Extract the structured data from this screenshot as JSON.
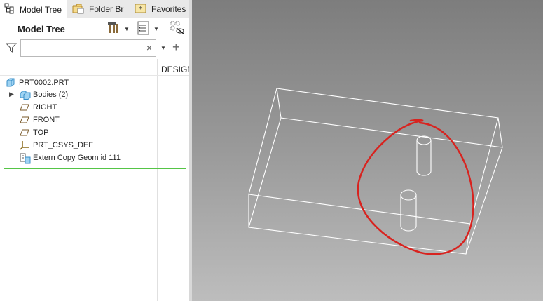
{
  "tabs": [
    {
      "label": "Model Tree",
      "icon": "model-tree-icon"
    },
    {
      "label": "Folder Br",
      "icon": "folder-browser-icon"
    },
    {
      "label": "Favorites",
      "icon": "favorites-icon"
    }
  ],
  "tree_header": {
    "title": "Model Tree",
    "tools": [
      "settings-tools-icon",
      "tree-columns-icon",
      "show-hide-icon"
    ]
  },
  "filter": {
    "search_value": "",
    "clear_symbol": "×",
    "add_symbol": "+"
  },
  "column_header": "DESIGN",
  "tree_items": [
    {
      "label": "PRT0002.PRT",
      "icon": "part-icon",
      "expandable": false
    },
    {
      "label": "Bodies (2)",
      "icon": "bodies-icon",
      "expandable": true
    },
    {
      "label": "RIGHT",
      "icon": "datum-plane-icon",
      "expandable": false
    },
    {
      "label": "FRONT",
      "icon": "datum-plane-icon",
      "expandable": false
    },
    {
      "label": "TOP",
      "icon": "datum-plane-icon",
      "expandable": false
    },
    {
      "label": "PRT_CSYS_DEF",
      "icon": "coordinate-system-icon",
      "expandable": false
    },
    {
      "label": "Extern Copy Geom id 111",
      "icon": "copy-geom-icon",
      "expandable": false
    }
  ],
  "insert_marker_color": "#55c546",
  "viewport": {
    "wireframe_color": "#ffffff",
    "annotation_color": "#d8231f",
    "background_top": "#7d7d7d",
    "background_bottom": "#bdbdbd"
  }
}
